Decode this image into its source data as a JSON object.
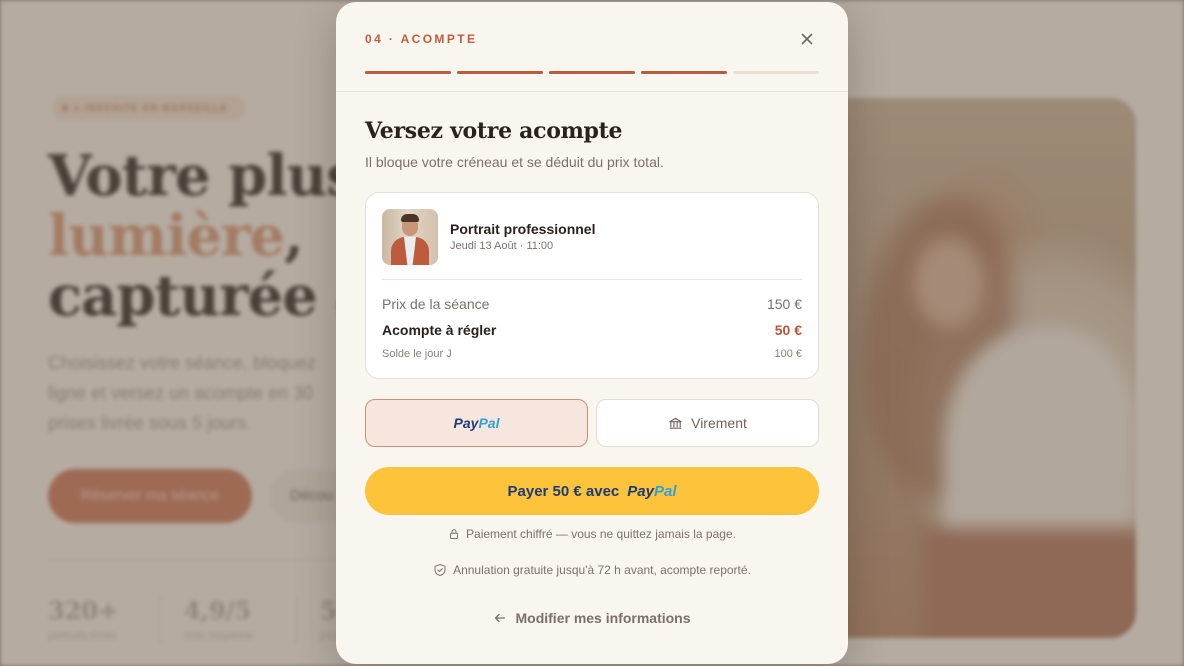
{
  "background": {
    "badge": "● INSCRITE EN MARSEILLE",
    "headline_line1": "Votre plus",
    "headline_line2": "lumière",
    "headline_line2_suffix": ",",
    "headline_line3": "capturée à",
    "lead_line1": "Choisissez votre séance, bloquez",
    "lead_line2": "ligne et versez un acompte en 30",
    "lead_line3": "prises livrée sous 5 jours.",
    "primary_button": "Réserver ma séance",
    "secondary_button": "Décou",
    "stats": [
      {
        "value": "320+",
        "label": "portraits livrés"
      },
      {
        "value": "4,9/5",
        "label": "note moyenne"
      },
      {
        "value": "5",
        "label": "jours"
      }
    ]
  },
  "modal": {
    "step_label": "04 · ACOMPTE",
    "progress": {
      "total_steps": 5,
      "completed_steps": 4
    },
    "title": "Versez votre acompte",
    "subtitle": "Il bloque votre créneau et se déduit du prix total.",
    "booking": {
      "service_name": "Portrait professionnel",
      "datetime": "Jeudi 13 Août · 11:00",
      "price_label": "Prix de la séance",
      "price_value": "150 €",
      "deposit_label": "Acompte à régler",
      "deposit_value": "50 €",
      "balance_label": "Solde le jour J",
      "balance_value": "100 €"
    },
    "payment_methods": {
      "paypal_part1": "Pay",
      "paypal_part2": "Pal",
      "transfer_label": "Virement",
      "selected": "paypal"
    },
    "pay_button": {
      "label": "Payer 50 € avec",
      "brand_part1": "Pay",
      "brand_part2": "Pal"
    },
    "security_note": "Paiement chiffré — vous ne quittez jamais la page.",
    "cancellation_note": "Annulation gratuite jusqu'à 72 h avant, acompte reporté.",
    "back_link": "Modifier mes informations"
  },
  "colors": {
    "accent": "#b75c3c",
    "paypal_yellow": "#fdc33a",
    "paypal_dark_blue": "#1d3b7a",
    "paypal_light_blue": "#2ea1db"
  }
}
